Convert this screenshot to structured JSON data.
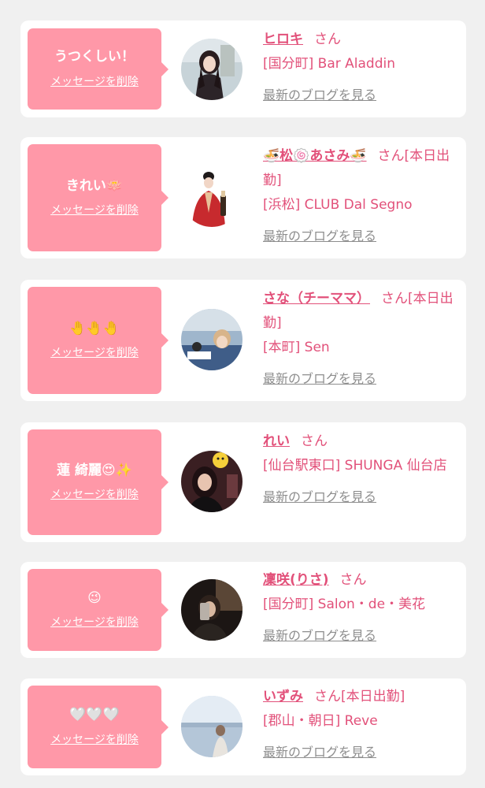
{
  "common": {
    "delete_label": "メッセージを削除",
    "blog_label": "最新のブログを見る",
    "san": "さん"
  },
  "messages": [
    {
      "comment": "うつくしい！",
      "name": "ヒロキ",
      "status": "",
      "shop": "[国分町] Bar Aladdin"
    },
    {
      "comment": "きれい🪷",
      "name": "🍜松🍥あさみ🍜",
      "status": "[本日出勤]",
      "shop": "[浜松] CLUB Dal Segno"
    },
    {
      "comment": "🤚🤚🤚",
      "name": "さな（チーママ）",
      "status": "[本日出勤]",
      "shop": "[本町] Sen"
    },
    {
      "comment": "蓮 綺麗😍✨",
      "name": "れい",
      "status": "",
      "shop": "[仙台駅東口] SHUNGA 仙台店"
    },
    {
      "comment": "😉",
      "name": "凜咲(りさ)",
      "status": "",
      "shop": "[国分町] Salon・de・美花"
    },
    {
      "comment": "🤍🤍🤍",
      "name": "いずみ",
      "status": "[本日出勤]",
      "shop": "[郡山・朝日] Reve"
    }
  ],
  "colors": {
    "bubble": "#ff98a8",
    "link": "#e2517a",
    "blog_link": "#8e8e8e",
    "background": "#f0f0f0"
  }
}
